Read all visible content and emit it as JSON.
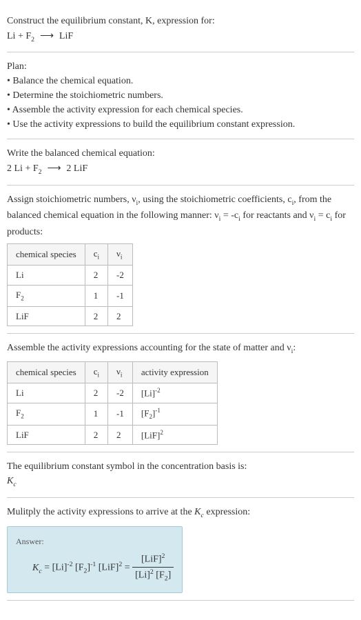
{
  "intro": {
    "line1": "Construct the equilibrium constant, K, expression for:",
    "eq_reactant1": "Li",
    "eq_plus": " + ",
    "eq_reactant2_base": "F",
    "eq_reactant2_sub": "2",
    "eq_arrow": " ⟶ ",
    "eq_product": "LiF"
  },
  "plan": {
    "header": "Plan:",
    "item1": "• Balance the chemical equation.",
    "item2": "• Determine the stoichiometric numbers.",
    "item3": "• Assemble the activity expression for each chemical species.",
    "item4": "• Use the activity expressions to build the equilibrium constant expression."
  },
  "balanced": {
    "text": "Write the balanced chemical equation:",
    "c1": "2 Li",
    "plus": " + ",
    "r2_base": "F",
    "r2_sub": "2",
    "arrow": " ⟶ ",
    "p1": "2 LiF"
  },
  "stoich": {
    "text1": "Assign stoichiometric numbers, ν",
    "text1_sub": "i",
    "text2": ", using the stoichiometric coefficients, c",
    "text2_sub": "i",
    "text3": ", from the balanced chemical equation in the following manner: ν",
    "text3_sub": "i",
    "text4": " = -c",
    "text4_sub": "i",
    "text5": " for reactants and ν",
    "text5_sub": "i",
    "text6": " = c",
    "text6_sub": "i",
    "text7": " for products:",
    "table": {
      "h1": "chemical species",
      "h2": "c",
      "h2_sub": "i",
      "h3": "ν",
      "h3_sub": "i",
      "rows": [
        {
          "species": "Li",
          "c": "2",
          "v": "-2"
        },
        {
          "species_base": "F",
          "species_sub": "2",
          "c": "1",
          "v": "-1"
        },
        {
          "species": "LiF",
          "c": "2",
          "v": "2"
        }
      ]
    }
  },
  "activity": {
    "text1": "Assemble the activity expressions accounting for the state of matter and ν",
    "text1_sub": "i",
    "text2": ":",
    "table": {
      "h1": "chemical species",
      "h2": "c",
      "h2_sub": "i",
      "h3": "ν",
      "h3_sub": "i",
      "h4": "activity expression",
      "rows": [
        {
          "species": "Li",
          "c": "2",
          "v": "-2",
          "expr_base": "[Li]",
          "expr_sup": "-2"
        },
        {
          "species_base": "F",
          "species_sub": "2",
          "c": "1",
          "v": "-1",
          "expr_base": "[F",
          "expr_mid_sub": "2",
          "expr_close": "]",
          "expr_sup": "-1"
        },
        {
          "species": "LiF",
          "c": "2",
          "v": "2",
          "expr_base": "[LiF]",
          "expr_sup": "2"
        }
      ]
    }
  },
  "symbol": {
    "text": "The equilibrium constant symbol in the concentration basis is:",
    "kc_base": "K",
    "kc_sub": "c"
  },
  "multiply": {
    "text1": "Mulitply the activity expressions to arrive at the ",
    "kc_base": "K",
    "kc_sub": "c",
    "text2": " expression:"
  },
  "answer": {
    "label": "Answer:",
    "kc_base": "K",
    "kc_sub": "c",
    "eq": " = ",
    "t1": "[Li]",
    "t1_sup": "-2",
    "sp": " ",
    "t2a": "[F",
    "t2_sub": "2",
    "t2b": "]",
    "t2_sup": "-1",
    "t3": "[LiF]",
    "t3_sup": "2",
    "eq2": " = ",
    "num": "[LiF]",
    "num_sup": "2",
    "den_a": "[Li]",
    "den_a_sup": "2",
    "den_b1": "[F",
    "den_b_sub": "2",
    "den_b2": "]"
  }
}
